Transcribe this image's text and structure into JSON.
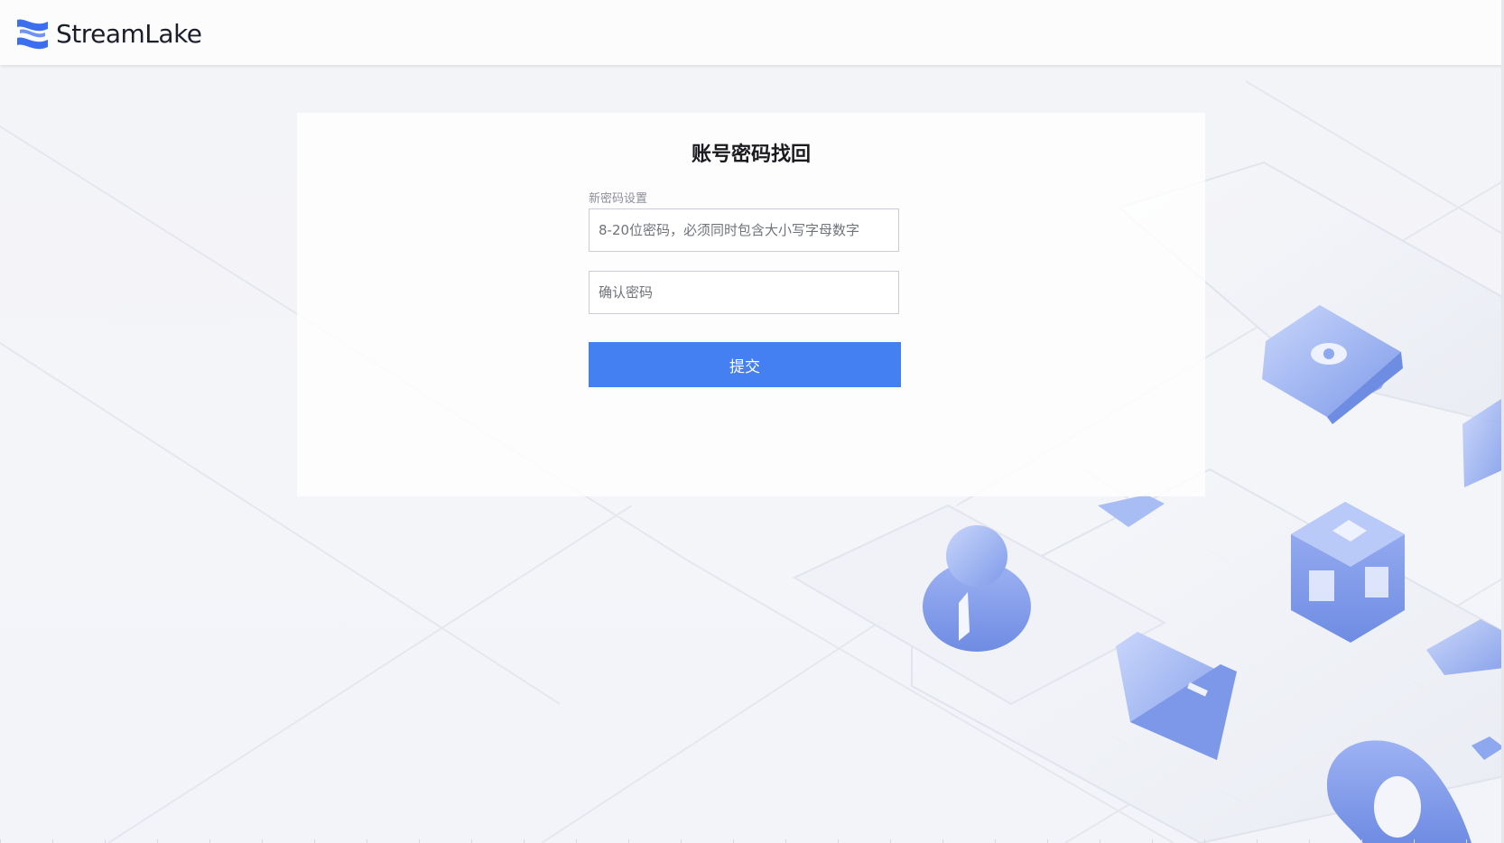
{
  "header": {
    "brand_name": "StreamLake",
    "logo_icon": "streamlake-logo-icon"
  },
  "form": {
    "title": "账号密码找回",
    "new_password_label": "新密码设置",
    "new_password_placeholder": "8-20位密码，必须同时包含大小写字母数字",
    "confirm_password_placeholder": "确认密码",
    "submit_label": "提交"
  },
  "colors": {
    "accent": "#4580f2",
    "brand_blue": "#3b6ff0",
    "background": "#f4f5f8",
    "illustration_blue": "#8ea8f0"
  },
  "decorations": {
    "icons": [
      "eye-icon",
      "user-icon",
      "cube-icon",
      "folder-icon",
      "ring-icon"
    ]
  }
}
